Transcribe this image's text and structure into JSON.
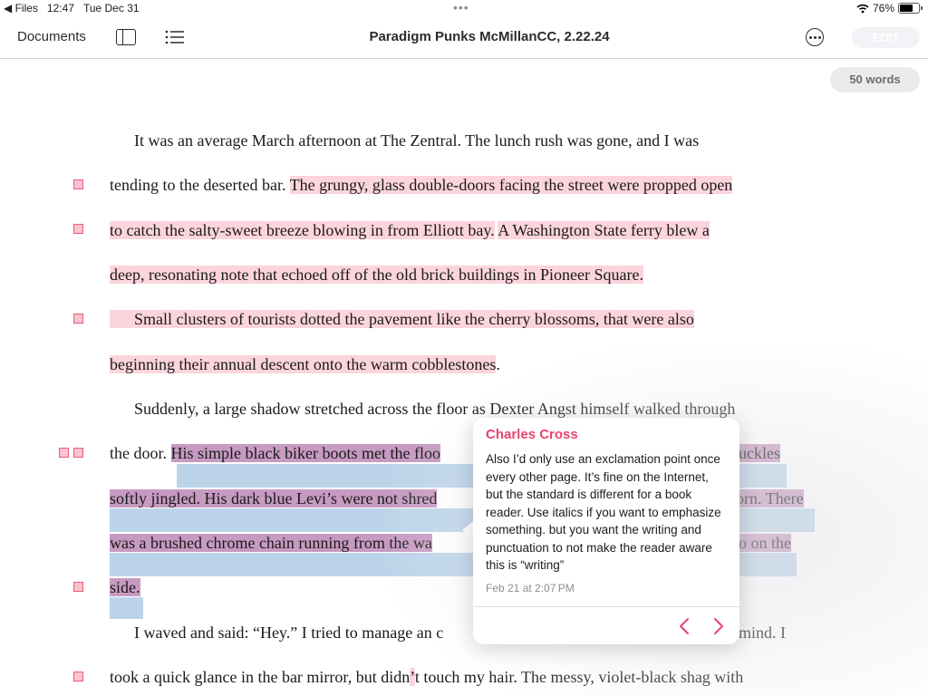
{
  "status": {
    "back_app": "Files",
    "time": "12:47",
    "date": "Tue Dec 31",
    "battery": "76%",
    "battery_level": 0.76
  },
  "nav": {
    "documents": "Documents",
    "title": "Paradigm Punks McMillanCC, 2.22.24",
    "edit": "EDIT"
  },
  "word_count": "50 words",
  "lines": [
    "It was an average March afternoon at The Zentral. The lunch rush was gone, and I was",
    "tending to the deserted bar. ",
    "The grungy, glass double-doors facing the street were propped open",
    "to catch the salty-sweet breeze blowing in from Elliott bay.",
    "A Washington State ferry blew a",
    "deep, resonating note that echoed off of the old brick buildings in Pioneer Square.",
    "Small clusters of tourists dotted the pavement like the cherry blossoms, that were also",
    "beginning their annual descent onto the warm cobblestones",
    ".",
    "Suddenly, a large shadow stretched across the floor as Dexter Angst himself walked through",
    "the door. ",
    "His simple black biker boots met the floo",
    "uckles",
    "softly jingled. His dark blue Levi’s were not shred",
    "orn. There",
    "was a brushed chrome chain running from the wa",
    "o on the",
    "side.",
    "I waved and said: “Hey.” I tried to manage an c",
    "mind. I",
    "took a quick glance in the bar mirror, but didn",
    "’",
    "t touch my hair. The messy, violet-black shag with"
  ],
  "comment": {
    "author": "Charles Cross",
    "text": "Also I’d only use an exclamation point once every other page. It’s fine on the Internet, but the standard is different for a book reader. Use italics if you want to emphasize something. but you want the writing and punctuation to not make the reader aware this is “writing”",
    "date": "Feb 21 at 2:07 PM"
  },
  "colors": {
    "accent": "#e8436e",
    "highlight_pink": "#fcd4dc",
    "highlight_purple": "#c79ac1",
    "selection_blue": "#bcd4ea"
  },
  "icons": [
    "back-arrow-icon",
    "wifi-icon",
    "battery-icon",
    "sidebar-icon",
    "list-icon",
    "more-icon",
    "chevron-left-icon",
    "chevron-right-icon",
    "comment-marker-icon"
  ]
}
